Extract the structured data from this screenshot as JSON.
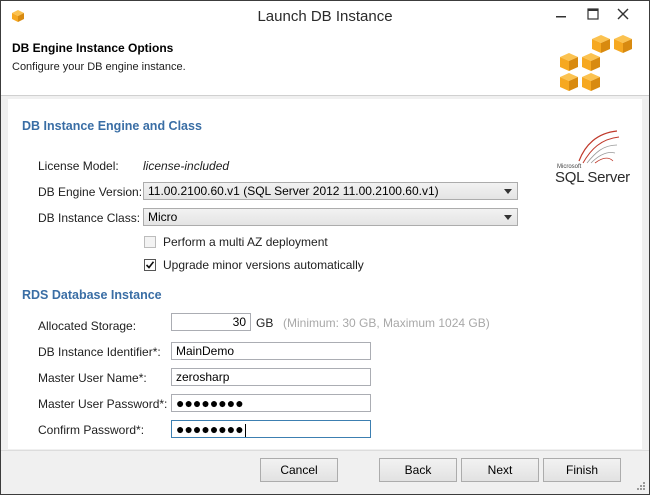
{
  "window": {
    "title": "Launch DB Instance"
  },
  "header": {
    "title": "DB Engine Instance Options",
    "subtitle": "Configure your DB engine instance."
  },
  "engine_section": {
    "title": "DB Instance Engine and Class",
    "license_label": "License Model:",
    "license_value": "license-included",
    "engine_version_label": "DB Engine Version:",
    "engine_version_value": "11.00.2100.60.v1 (SQL Server 2012 11.00.2100.60.v1)",
    "instance_class_label": "DB Instance Class:",
    "instance_class_value": "Micro",
    "multi_az_label": "Perform a multi AZ deployment",
    "multi_az_checked": false,
    "multi_az_enabled": false,
    "upgrade_label": "Upgrade minor versions automatically",
    "upgrade_checked": true,
    "logo_small_text": "Microsoft",
    "logo_text": "SQL Server"
  },
  "rds_section": {
    "title": "RDS Database Instance",
    "storage_label": "Allocated Storage:",
    "storage_value": "30",
    "storage_unit": "GB",
    "storage_hint": "(Minimum: 30 GB, Maximum 1024 GB)",
    "identifier_label": "DB Instance Identifier*:",
    "identifier_value": "MainDemo",
    "username_label": "Master User Name*:",
    "username_value": "zerosharp",
    "password_label": "Master User Password*:",
    "password_value": "●●●●●●●●",
    "confirm_label": "Confirm Password*:",
    "confirm_value": "●●●●●●●●"
  },
  "footer": {
    "cancel": "Cancel",
    "back": "Back",
    "next": "Next",
    "finish": "Finish"
  },
  "colors": {
    "section_title": "#3a6ea5",
    "aws_orange": "#f6a821",
    "hint_gray": "#a8a8a8"
  }
}
